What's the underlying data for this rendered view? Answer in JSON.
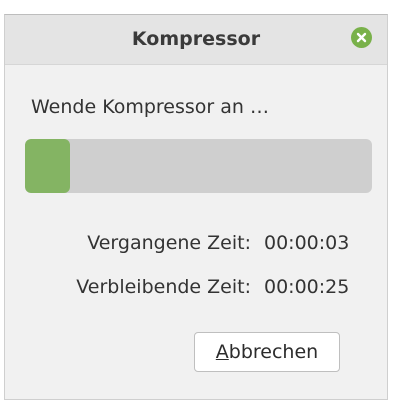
{
  "window": {
    "title": "Kompressor",
    "close_label": "Schließen"
  },
  "status": {
    "text": "Wende Kompressor an …"
  },
  "progress": {
    "value": 0.13
  },
  "times": {
    "elapsed_label": "Vergangene Zeit:",
    "elapsed_value": "00:00:03",
    "remaining_label": "Verbleibende Zeit:",
    "remaining_value": "00:00:25"
  },
  "buttons": {
    "cancel_mnemonic": "A",
    "cancel_rest": "bbrechen"
  },
  "colors": {
    "accent": "#84b463",
    "close": "#79b14a",
    "track": "#cfcfcf"
  }
}
